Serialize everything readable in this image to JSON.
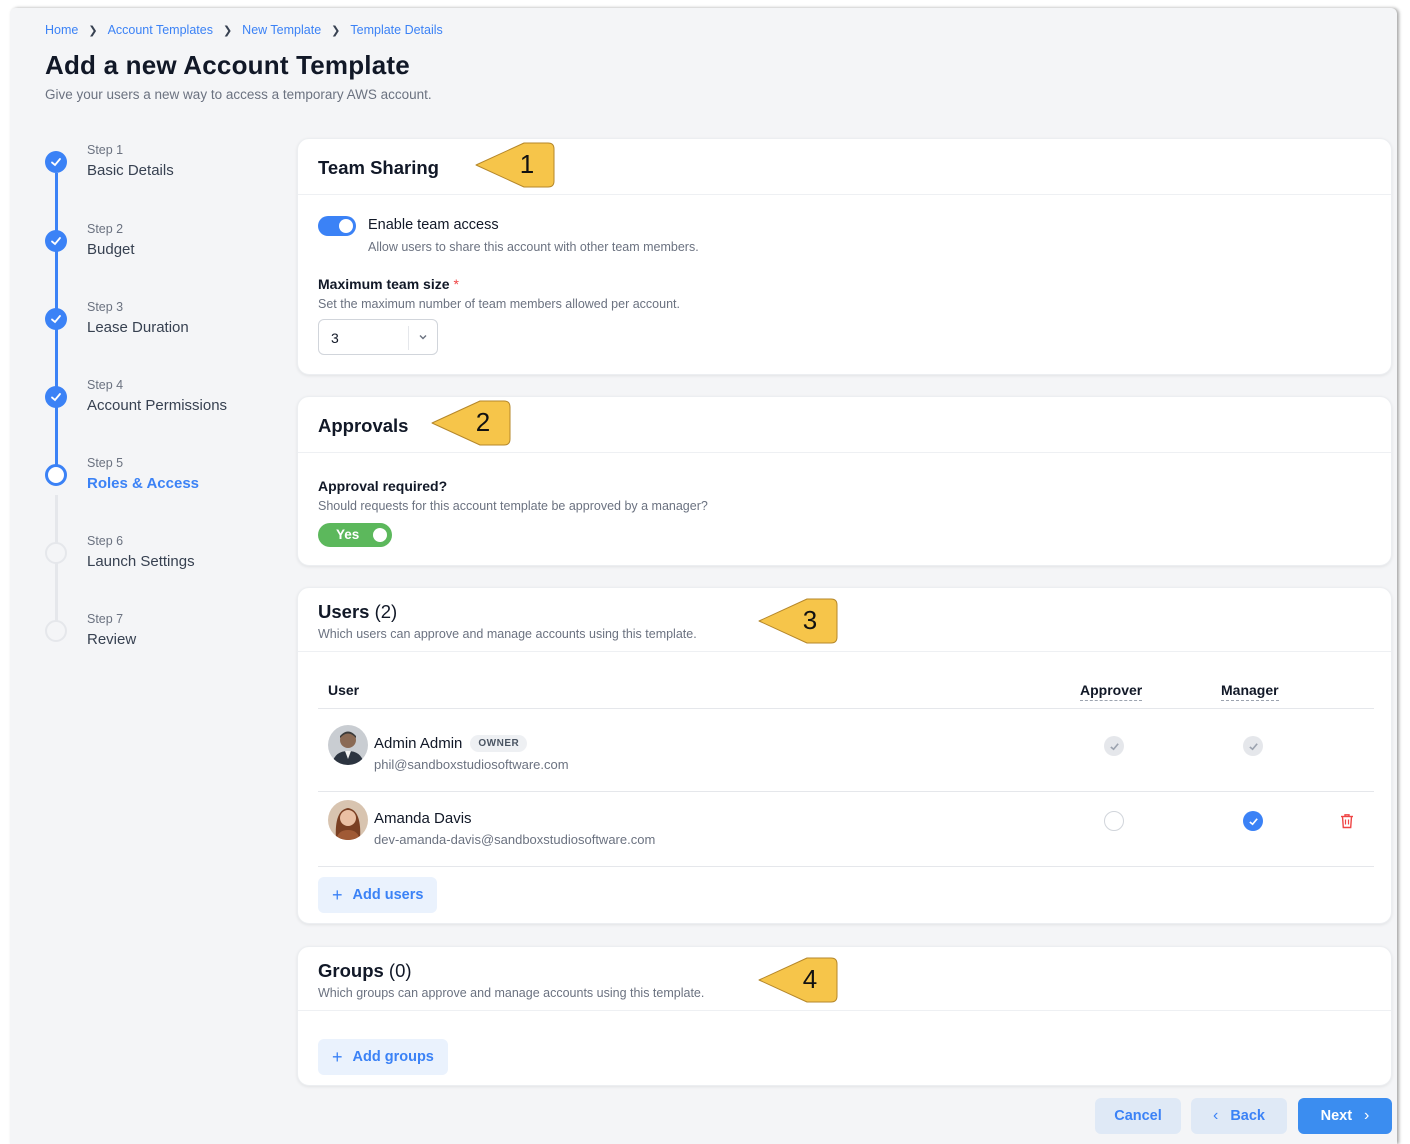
{
  "breadcrumb": [
    "Home",
    "Account Templates",
    "New Template",
    "Template Details"
  ],
  "page": {
    "title": "Add a new Account Template",
    "subtitle": "Give your users a new way to access a temporary AWS account."
  },
  "steps": [
    {
      "num": "Step 1",
      "label": "Basic Details",
      "state": "done"
    },
    {
      "num": "Step 2",
      "label": "Budget",
      "state": "done"
    },
    {
      "num": "Step 3",
      "label": "Lease Duration",
      "state": "done"
    },
    {
      "num": "Step 4",
      "label": "Account Permissions",
      "state": "done"
    },
    {
      "num": "Step 5",
      "label": "Roles & Access",
      "state": "current"
    },
    {
      "num": "Step 6",
      "label": "Launch Settings",
      "state": "todo"
    },
    {
      "num": "Step 7",
      "label": "Review",
      "state": "todo"
    }
  ],
  "team_sharing": {
    "title": "Team Sharing",
    "callout": "1",
    "toggle_label": "Enable team access",
    "toggle_hint": "Allow users to share this account with other team members.",
    "toggle_on": true,
    "size_label": "Maximum team size",
    "required_mark": "*",
    "size_hint": "Set the maximum number of team members allowed per account.",
    "size_value": "3"
  },
  "approvals": {
    "title": "Approvals",
    "callout": "2",
    "question": "Approval required?",
    "hint": "Should requests for this account template be approved by a manager?",
    "toggle_text": "Yes"
  },
  "users": {
    "title": "Users",
    "count": "(2)",
    "callout": "3",
    "description": "Which users can approve and manage accounts using this template.",
    "columns": {
      "user": "User",
      "approver": "Approver",
      "manager": "Manager"
    },
    "rows": [
      {
        "name": "Admin Admin",
        "badge": "OWNER",
        "email": "phil@sandboxstudiosoftware.com",
        "approver": "disabled",
        "manager": "disabled"
      },
      {
        "name": "Amanda Davis",
        "badge": "",
        "email": "dev-amanda-davis@sandboxstudiosoftware.com",
        "approver": "unchecked",
        "manager": "checked"
      }
    ],
    "add_label": "Add users"
  },
  "groups": {
    "title": "Groups",
    "count": "(0)",
    "callout": "4",
    "description": "Which groups can approve and manage accounts using this template.",
    "add_label": "Add groups"
  },
  "footer": {
    "cancel": "Cancel",
    "back": "Back",
    "next": "Next"
  },
  "colors": {
    "accent": "#3b82f6",
    "success": "#5cb85c",
    "callout": "#f6c54a",
    "danger": "#ef4444"
  }
}
